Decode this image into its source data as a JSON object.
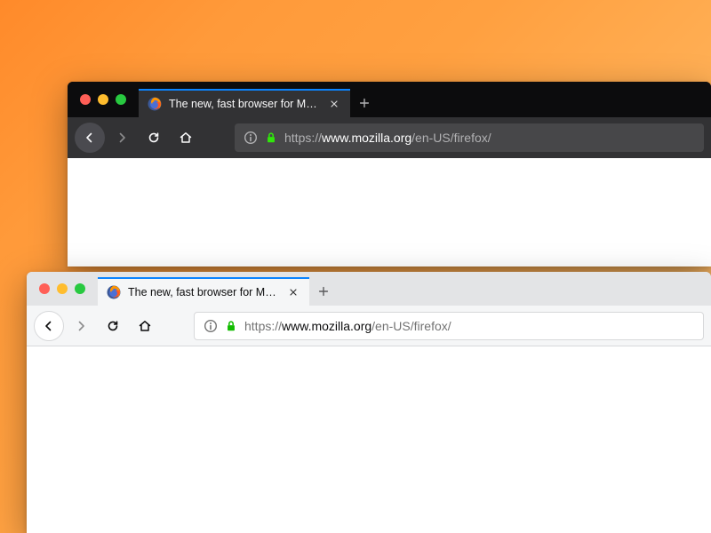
{
  "windows": {
    "dark": {
      "tab_title": "The new, fast browser for Mac,",
      "url_scheme": "https://",
      "url_host": "www.mozilla.org",
      "url_path": "/en-US/firefox/"
    },
    "light": {
      "tab_title": "The new, fast browser for Mac,",
      "url_scheme": "https://",
      "url_host": "www.mozilla.org",
      "url_path": "/en-US/firefox/"
    }
  },
  "colors": {
    "accent": "#0a84ff",
    "lock": "#30e60b"
  }
}
